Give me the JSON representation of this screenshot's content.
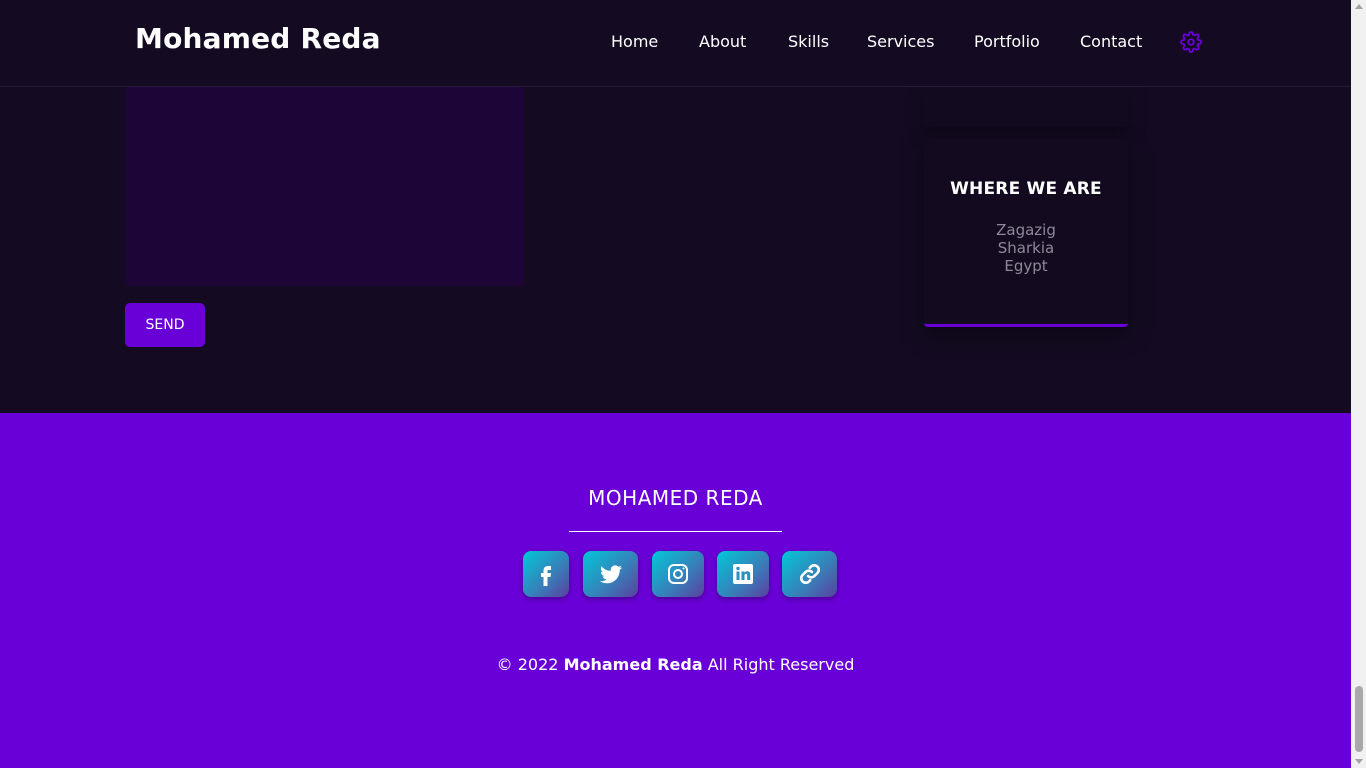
{
  "header": {
    "brand": "Mohamed Reda",
    "nav": [
      "Home",
      "About",
      "Skills",
      "Services",
      "Portfolio",
      "Contact"
    ],
    "settings_icon": "gear-icon"
  },
  "contact": {
    "message_value": "",
    "send_label": "SEND",
    "location_card": {
      "title": "WHERE WE ARE",
      "lines": [
        "Zagazig",
        "Sharkia",
        "Egypt"
      ]
    }
  },
  "footer": {
    "title": "MOHAMED REDA",
    "social_icons": [
      "facebook-icon",
      "twitter-icon",
      "instagram-icon",
      "linkedin-icon",
      "link-icon"
    ],
    "copyright_prefix": "© 2022",
    "copyright_name": "Mohamed Reda",
    "copyright_suffix": "All Right Reserved"
  },
  "colors": {
    "accent": "#6a00d8",
    "dark_bg": "#140b22",
    "textarea_bg": "#1d0538",
    "muted_text": "#8e8898"
  }
}
